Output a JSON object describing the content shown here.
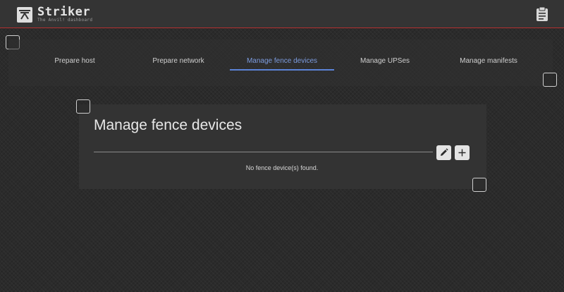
{
  "header": {
    "title": "Striker",
    "subtitle": "The Anvil! dashboard",
    "logo_icon": "anvil-logo-icon",
    "action_icon": "clipboard-icon",
    "accent_color": "#b5302f"
  },
  "tabs": [
    {
      "label": "Prepare host",
      "active": false
    },
    {
      "label": "Prepare network",
      "active": false
    },
    {
      "label": "Manage fence devices",
      "active": true
    },
    {
      "label": "Manage UPSes",
      "active": false
    },
    {
      "label": "Manage manifests",
      "active": false
    }
  ],
  "tab_active_color": "#5b83d8",
  "panel": {
    "title": "Manage fence devices",
    "edit_icon": "pencil-icon",
    "add_icon": "plus-icon",
    "empty_message": "No fence device(s) found."
  }
}
